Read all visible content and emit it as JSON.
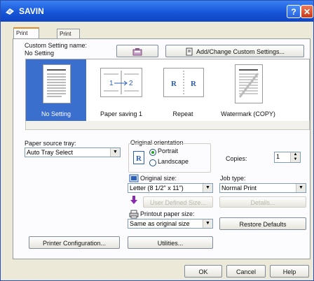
{
  "window": {
    "title": "SAVIN"
  },
  "tabs": [
    {
      "label": "Print Settings"
    },
    {
      "label": "Print Quality"
    }
  ],
  "custom_setting": {
    "label": "Custom Setting name:",
    "value": "No Setting",
    "add_change_label": "Add/Change Custom Settings..."
  },
  "presets": [
    {
      "label": "No Setting"
    },
    {
      "label": "Paper saving 1"
    },
    {
      "label": "Repeat"
    },
    {
      "label": "Watermark (COPY)"
    }
  ],
  "paper_source": {
    "label": "Paper source tray:",
    "value": "Auto Tray Select"
  },
  "orientation": {
    "label": "Original orientation",
    "options": [
      {
        "label": "Portrait"
      },
      {
        "label": "Landscape"
      }
    ],
    "selected": "Portrait"
  },
  "copies": {
    "label": "Copies:",
    "value": "1"
  },
  "original_size": {
    "label": "Original size:",
    "value": "Letter (8 1/2\" x 11\")"
  },
  "job_type": {
    "label": "Job type:",
    "value": "Normal Print"
  },
  "user_defined_label": "User Defined Size...",
  "details_label": "Details...",
  "printout_size": {
    "label": "Printout paper size:",
    "value": "Same as original size"
  },
  "restore_defaults_label": "Restore Defaults",
  "printer_config_label": "Printer Configuration...",
  "utilities_label": "Utilities...",
  "footer": {
    "ok_label": "OK",
    "cancel_label": "Cancel",
    "help_label": "Help"
  },
  "colors": {
    "title_bar": "#0f45c4",
    "selection": "#3b6fcd",
    "tab_highlight": "#e68b2c",
    "dialog_bg": "#ece9d8"
  }
}
